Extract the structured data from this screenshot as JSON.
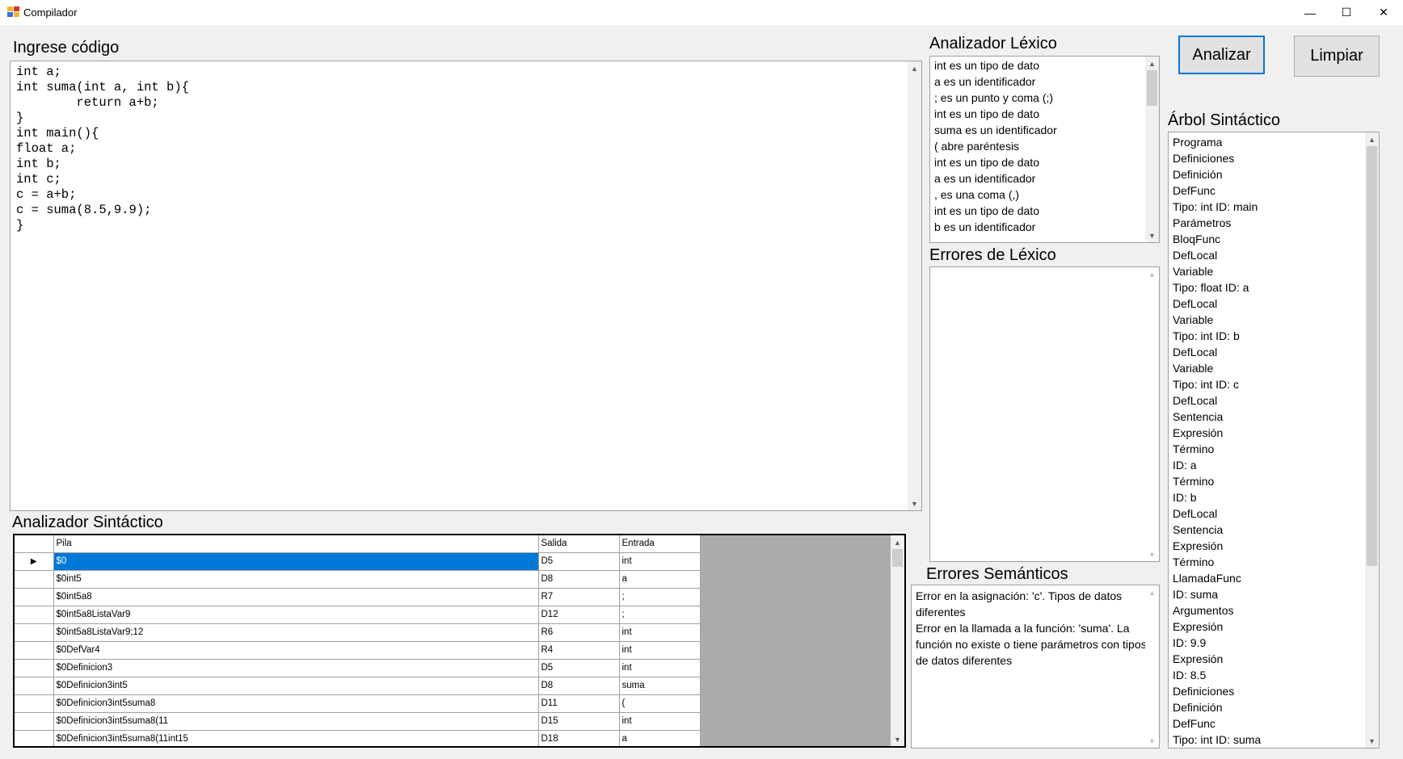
{
  "window": {
    "title": "Compilador",
    "controls": {
      "minimize": "—",
      "maximize": "☐",
      "close": "✕"
    }
  },
  "code_editor": {
    "label": "Ingrese código",
    "lines": [
      "int a;",
      "int suma(int a, int b){",
      "\treturn a+b;",
      "}",
      "",
      "int main(){",
      "float a;",
      "int b;",
      "int c;",
      "c = a+b;",
      "c = suma(8.5,9.9);",
      "}"
    ]
  },
  "lexico": {
    "label": "Analizador Léxico",
    "items": [
      "int es un tipo de dato",
      "a es un identificador",
      "; es un punto y coma (;)",
      "int es un tipo de dato",
      "suma es un identificador",
      "( abre paréntesis",
      "int es un tipo de dato",
      "a es un identificador",
      ", es una coma (,)",
      "int es un tipo de dato",
      "b es un identificador"
    ]
  },
  "errores_lexico": {
    "label": "Errores de Léxico",
    "items": []
  },
  "errores_semanticos": {
    "label": "Errores Semánticos",
    "lines": [
      "Error en la asignación: 'c'. Tipos de datos",
      "diferentes",
      "Error en la llamada a la función: 'suma'. La",
      "función no existe o tiene parámetros con tipos",
      "de datos diferentes"
    ]
  },
  "buttons": {
    "analizar": "Analizar",
    "limpiar": "Limpiar"
  },
  "arbol": {
    "label": "Árbol Sintáctico",
    "items": [
      "Programa",
      "Definiciones",
      "Definición",
      "DefFunc",
      "Tipo: int ID: main",
      "Parámetros",
      "BloqFunc",
      "DefLocal",
      "Variable",
      "Tipo: float ID: a",
      "DefLocal",
      "Variable",
      "Tipo: int ID: b",
      "DefLocal",
      "Variable",
      "Tipo: int ID: c",
      "DefLocal",
      "Sentencia",
      "Expresión",
      "Término",
      "ID: a",
      "Término",
      "ID: b",
      "DefLocal",
      "Sentencia",
      "Expresión",
      "Término",
      "LlamadaFunc",
      "ID: suma",
      "Argumentos",
      "Expresión",
      "ID: 9.9",
      "Expresión",
      "ID: 8.5",
      "Definiciones",
      "Definición",
      "DefFunc",
      "Tipo: int ID: suma"
    ]
  },
  "sintactico": {
    "label": "Analizador Sintáctico",
    "columns": [
      "Pila",
      "Salida",
      "Entrada"
    ],
    "rows": [
      {
        "pila": "$0",
        "salida": "D5",
        "entrada": "int",
        "selected": true
      },
      {
        "pila": "$0int5",
        "salida": "D8",
        "entrada": "a"
      },
      {
        "pila": "$0int5a8",
        "salida": "R7",
        "entrada": ";"
      },
      {
        "pila": "$0int5a8ListaVar9",
        "salida": "D12",
        "entrada": ";"
      },
      {
        "pila": "$0int5a8ListaVar9;12",
        "salida": "R6",
        "entrada": "int"
      },
      {
        "pila": "$0DefVar4",
        "salida": "R4",
        "entrada": "int"
      },
      {
        "pila": "$0Definicion3",
        "salida": "D5",
        "entrada": "int"
      },
      {
        "pila": "$0Definicion3int5",
        "salida": "D8",
        "entrada": "suma"
      },
      {
        "pila": "$0Definicion3int5suma8",
        "salida": "D11",
        "entrada": "("
      },
      {
        "pila": "$0Definicion3int5suma8(11",
        "salida": "D15",
        "entrada": "int"
      },
      {
        "pila": "$0Definicion3int5suma8(11int15",
        "salida": "D18",
        "entrada": "a"
      }
    ]
  },
  "colors": {
    "selection": "#0078d7",
    "background": "#f0f0f0",
    "grid_empty": "#ababab"
  }
}
